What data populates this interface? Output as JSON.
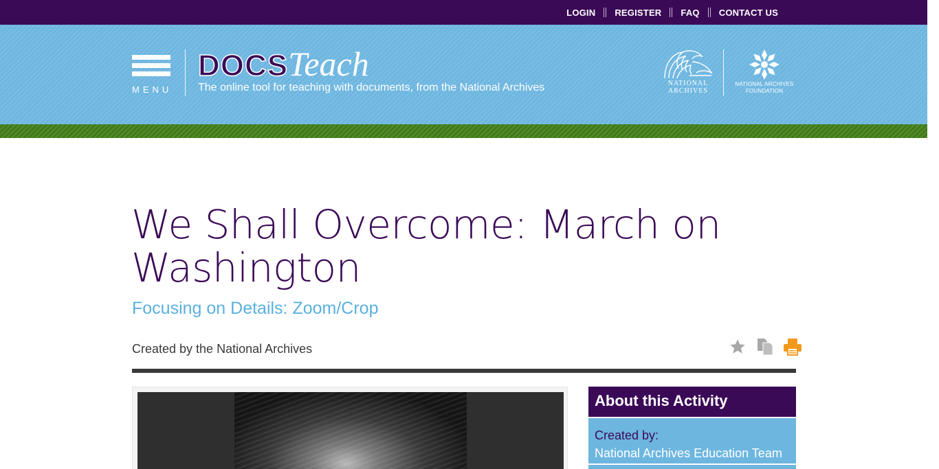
{
  "top_nav": {
    "items": [
      "LOGIN",
      "REGISTER",
      "FAQ",
      "CONTACT US"
    ]
  },
  "header": {
    "menu_label": "MENU",
    "logo_docs": "DOCS",
    "logo_teach": "Teach",
    "tagline": "The online tool for teaching with documents, from the National Archives",
    "na_logo_line1": "NATIONAL",
    "na_logo_line2": "ARCHIVES",
    "naf_logo_line1": "NATIONAL ARCHIVES",
    "naf_logo_line2": "FOUNDATION"
  },
  "activity": {
    "title": "We Shall Overcome: March on Washington",
    "subtitle": "Focusing on Details: Zoom/Crop",
    "created_by_line": "Created by the National Archives"
  },
  "tools": {
    "icons": [
      "star-icon",
      "copy-icon",
      "print-icon"
    ],
    "colors": {
      "star": "#a8a8a8",
      "copy": "#a8a8a8",
      "print": "#f39a1e"
    }
  },
  "sidebar": {
    "heading": "About this Activity",
    "created_by_label": "Created by:",
    "created_by_value": "National Archives Education Team"
  },
  "colors": {
    "purple": "#3b0a57",
    "banner_blue": "#6db6e0",
    "green": "#3f7b15",
    "subtitle_blue": "#5ab0de"
  }
}
